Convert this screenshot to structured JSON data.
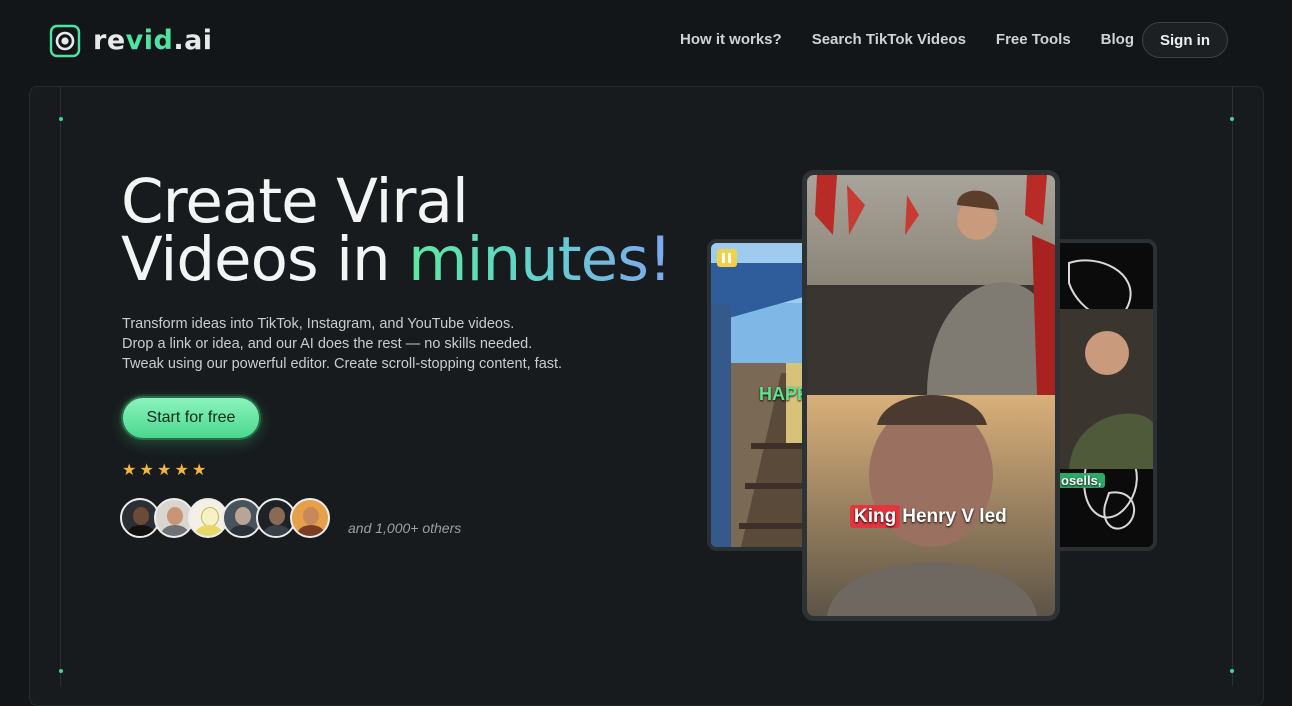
{
  "brand": {
    "name_prefix": "re",
    "name_accent": "vid",
    "name_suffix": ".ai",
    "accent_color": "#4fe3a0"
  },
  "nav": {
    "items": [
      "How it works?",
      "Search TikTok Videos",
      "Free Tools",
      "Blog"
    ],
    "signin_label": "Sign in"
  },
  "hero": {
    "headline_line1": "Create Viral",
    "headline_line2_plain": "Videos in ",
    "headline_line2_accent": "minutes!",
    "description": [
      "Transform ideas into TikTok, Instagram, and YouTube videos.",
      "Drop a link or idea, and our AI does the rest — no skills needed.",
      "Tweak using our powerful editor. Create scroll-stopping content, fast."
    ],
    "cta_label": "Start for free",
    "rating_stars": 5,
    "social_proof": "and 1,000+ others"
  },
  "preview_cards": {
    "left_caption": "HAPP",
    "main_caption_highlight": "King",
    "main_caption_rest": "Henry V led",
    "right_caption": "osells,"
  },
  "colors": {
    "star": "#f4b63f",
    "cta_top": "#8cf3bd",
    "cta_bottom": "#4bd88f"
  }
}
